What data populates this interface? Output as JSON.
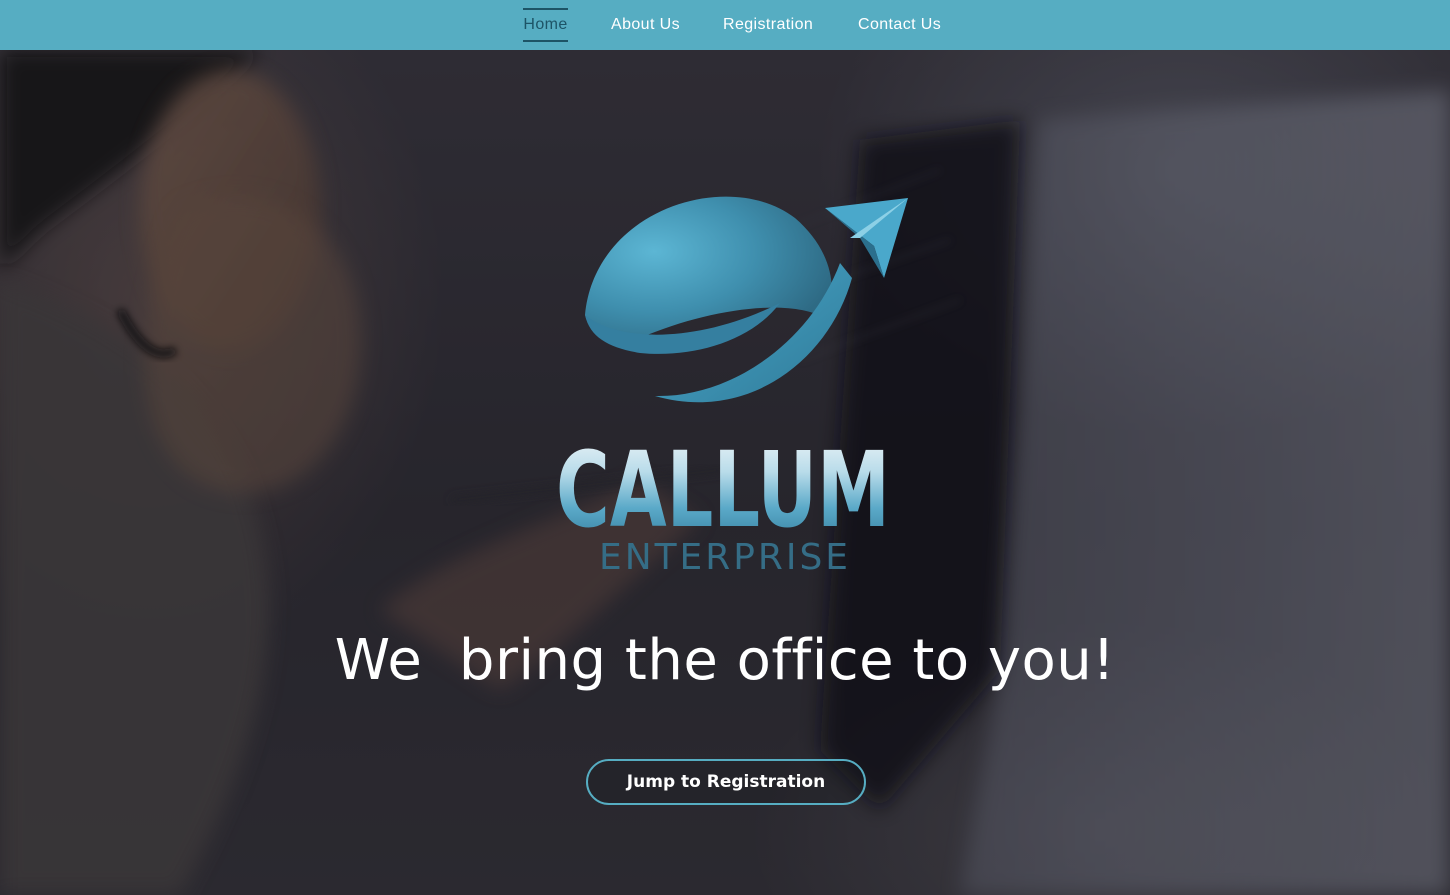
{
  "nav": {
    "items": [
      {
        "label": "Home",
        "active": true
      },
      {
        "label": "About Us",
        "active": false
      },
      {
        "label": "Registration",
        "active": false
      },
      {
        "label": "Contact Us",
        "active": false
      }
    ]
  },
  "logo": {
    "brand": "CALLUM",
    "subtitle": "ENTERPRISE",
    "icon": "globe-with-paper-plane-icon"
  },
  "hero": {
    "tagline": "We  bring the office to you!",
    "background": "blurred photo of woman with headset writing with a stylus in front of a monitor"
  },
  "cta": {
    "label": "Jump to Registration"
  },
  "colors": {
    "nav_bg": "#56adc2",
    "nav_active": "#1d5466",
    "cta_border": "#56adc2",
    "logo_blue": "#3b8fb0"
  }
}
